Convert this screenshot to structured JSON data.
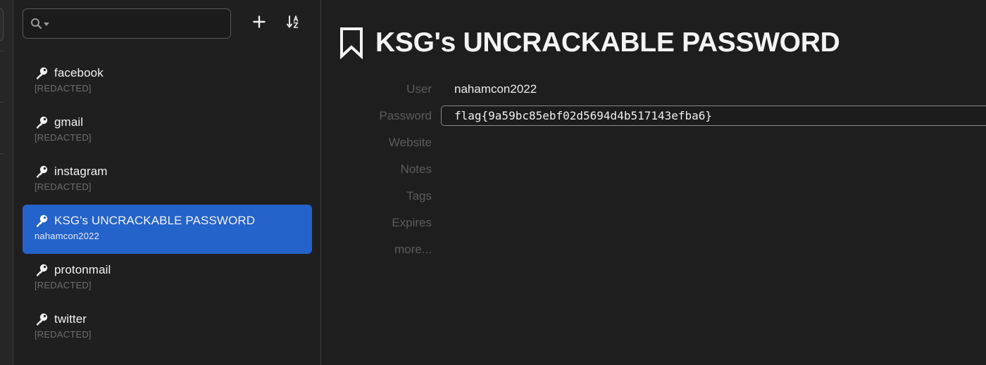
{
  "search": {
    "placeholder": "",
    "value": ""
  },
  "toolbar": {
    "add_icon": "plus-icon",
    "sort_icon": "sort-az-icon"
  },
  "entries": [
    {
      "title": "facebook",
      "subtitle": "[REDACTED]",
      "icon": "key-icon",
      "selected": false
    },
    {
      "title": "gmail",
      "subtitle": "[REDACTED]",
      "icon": "key-icon",
      "selected": false
    },
    {
      "title": "instagram",
      "subtitle": "[REDACTED]",
      "icon": "key-icon",
      "selected": false
    },
    {
      "title": "KSG's UNCRACKABLE PASSWORD",
      "subtitle": "nahamcon2022",
      "icon": "key-icon",
      "selected": true
    },
    {
      "title": "protonmail",
      "subtitle": "[REDACTED]",
      "icon": "key-icon",
      "selected": false
    },
    {
      "title": "twitter",
      "subtitle": "[REDACTED]",
      "icon": "key-icon",
      "selected": false
    }
  ],
  "detail": {
    "icon": "bookmark-icon",
    "title": "KSG's UNCRACKABLE PASSWORD",
    "fields": {
      "user_label": "User",
      "user_value": "nahamcon2022",
      "password_label": "Password",
      "password_value": "flag{9a59bc85ebf02d5694d4b517143efba6}",
      "website_label": "Website",
      "notes_label": "Notes",
      "tags_label": "Tags",
      "expires_label": "Expires",
      "more_label": "more..."
    }
  },
  "colors": {
    "selection": "#2463c9",
    "background": "#1e1e1e",
    "label": "#5c5c5c",
    "redacted": "#6e6e6e"
  }
}
